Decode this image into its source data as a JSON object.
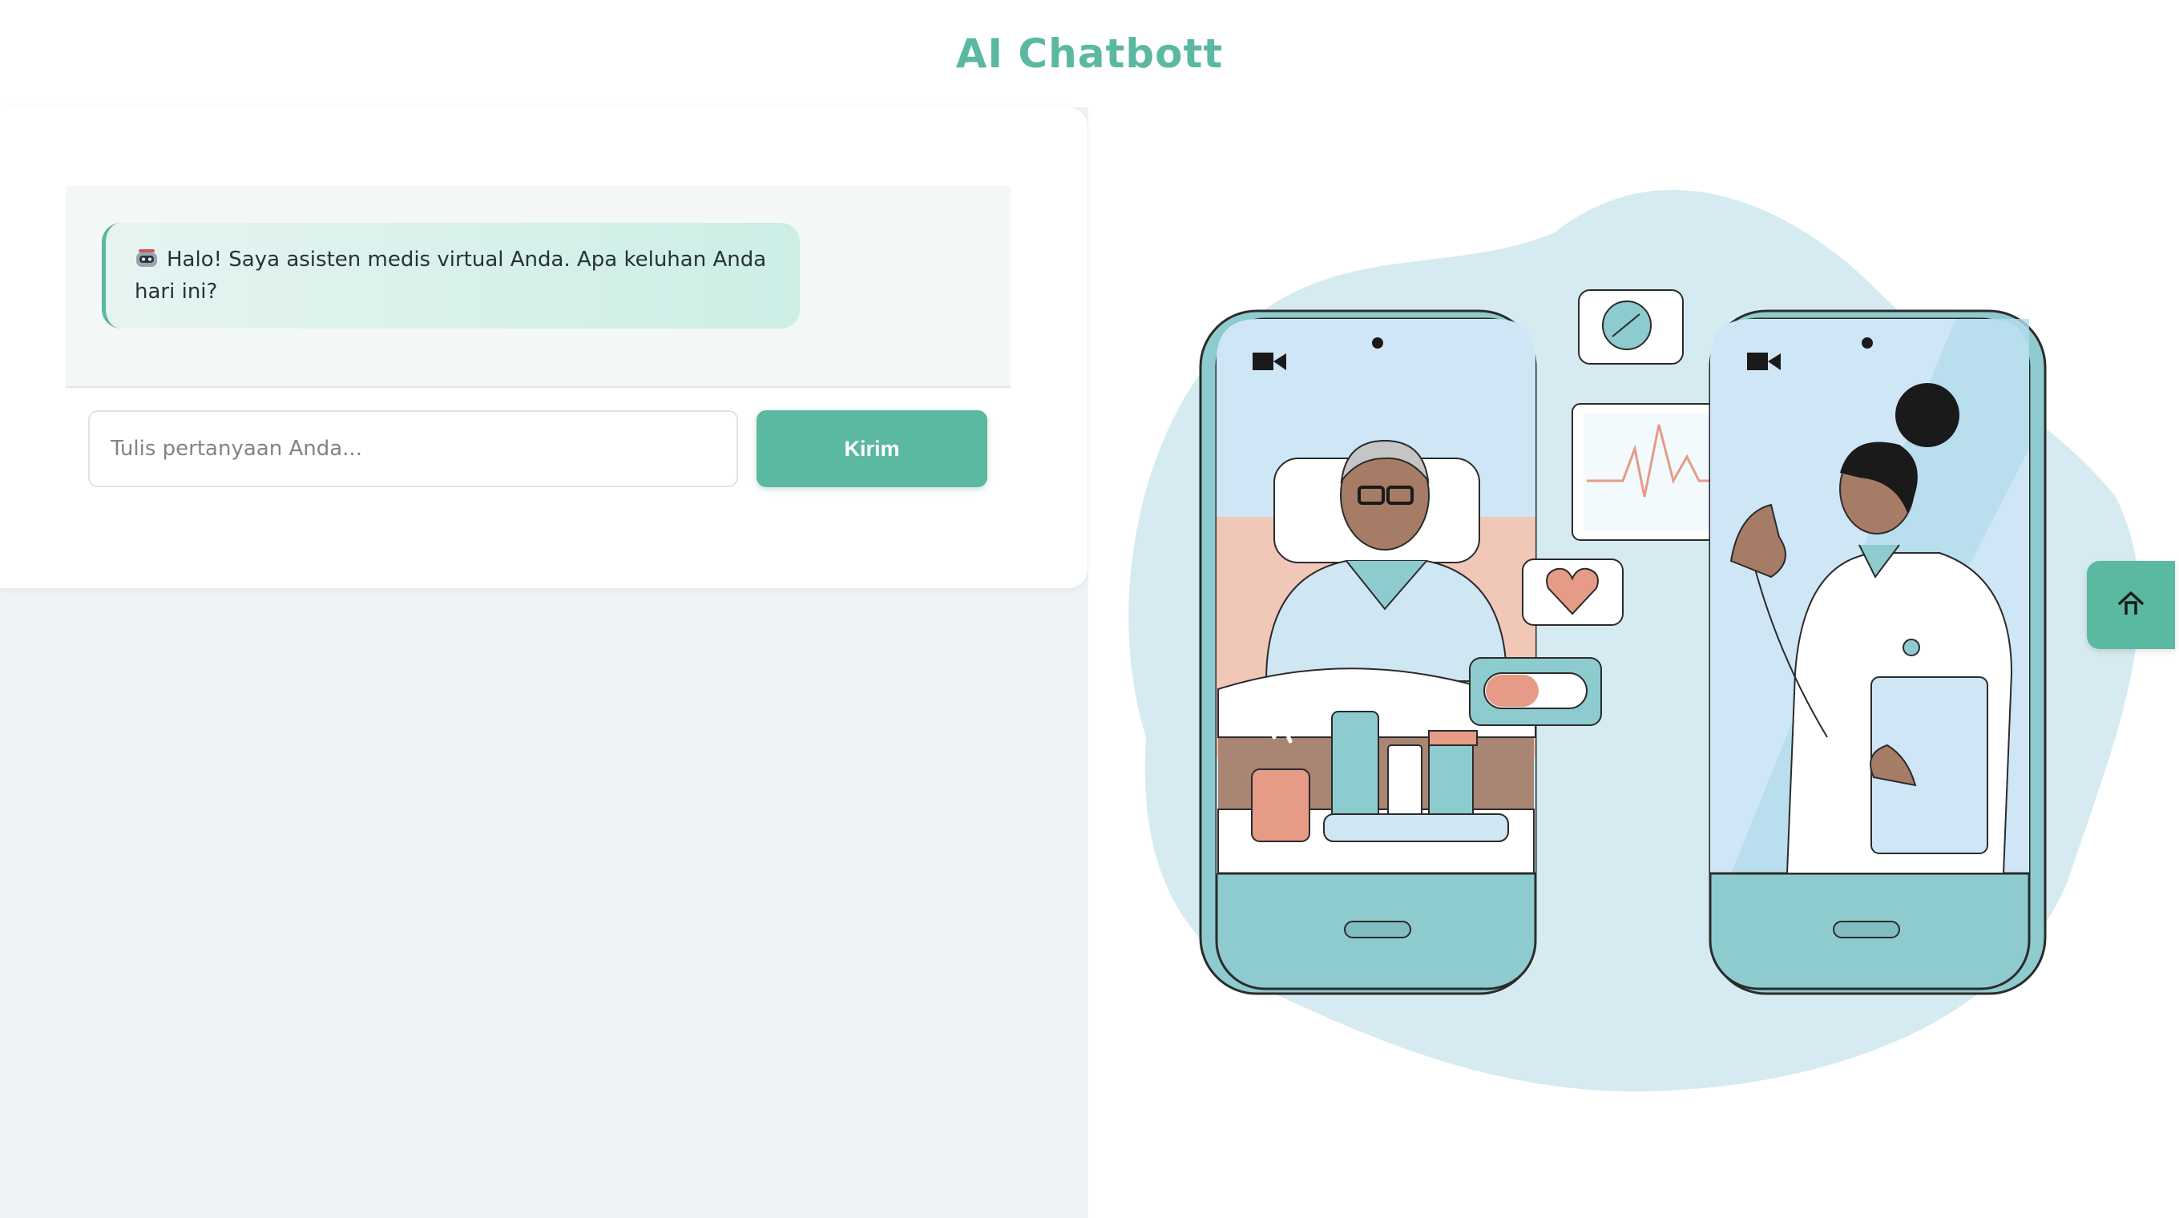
{
  "header": {
    "title": "AI Chatbott"
  },
  "chat": {
    "messages": [
      {
        "sender": "bot",
        "icon": "robot-icon",
        "text": "Halo! Saya asisten medis virtual Anda. Apa keluhan Anda hari ini?"
      }
    ],
    "input": {
      "placeholder": "Tulis pertanyaan Anda...",
      "value": ""
    },
    "send_label": "Kirim"
  },
  "home_button": {
    "icon": "home-icon"
  },
  "colors": {
    "accent": "#5bb8a1",
    "left_background": "#eff3f7",
    "bubble_start": "#e6f4f1",
    "bubble_end": "#cceee5",
    "illustration_blob": "#d6ebf1"
  }
}
